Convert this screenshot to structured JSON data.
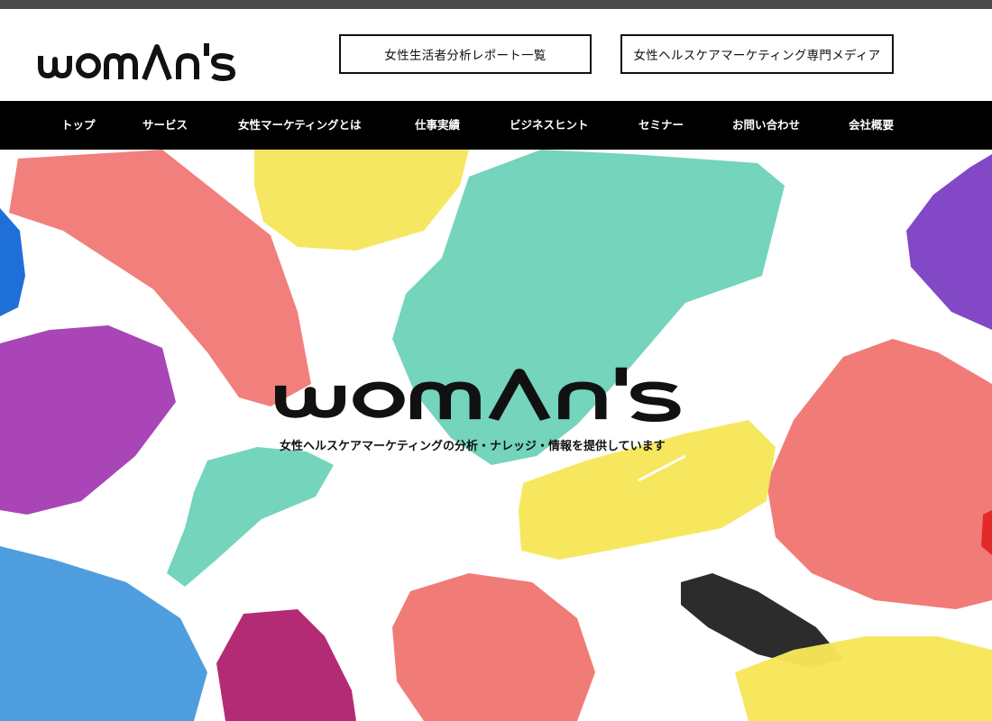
{
  "brand": {
    "logo_text": "woman's"
  },
  "header": {
    "buttons": [
      {
        "label": "女性生活者分析レポート一覧"
      },
      {
        "label": "女性ヘルスケアマーケティング専門メディア"
      }
    ]
  },
  "nav": {
    "items": [
      {
        "label": "トップ"
      },
      {
        "label": "サービス"
      },
      {
        "label": "女性マーケティングとは"
      },
      {
        "label": "仕事実績"
      },
      {
        "label": "ビジネスヒント"
      },
      {
        "label": "セミナー"
      },
      {
        "label": "お問い合わせ"
      },
      {
        "label": "会社概要"
      }
    ]
  },
  "hero": {
    "logo_text": "woman's",
    "tagline": "女性ヘルスケアマーケティングの分析・ナレッジ・情報を提供しています"
  },
  "colors": {
    "coral": "#f07470",
    "teal": "#6dd2b8",
    "yellow": "#f6e65a",
    "purple": "#a43bb3",
    "blue": "#3b94dc",
    "violet": "#7b3ec2",
    "magenta": "#b0206e",
    "charcoal": "#2c2c2c",
    "nav_bg": "#000000"
  }
}
